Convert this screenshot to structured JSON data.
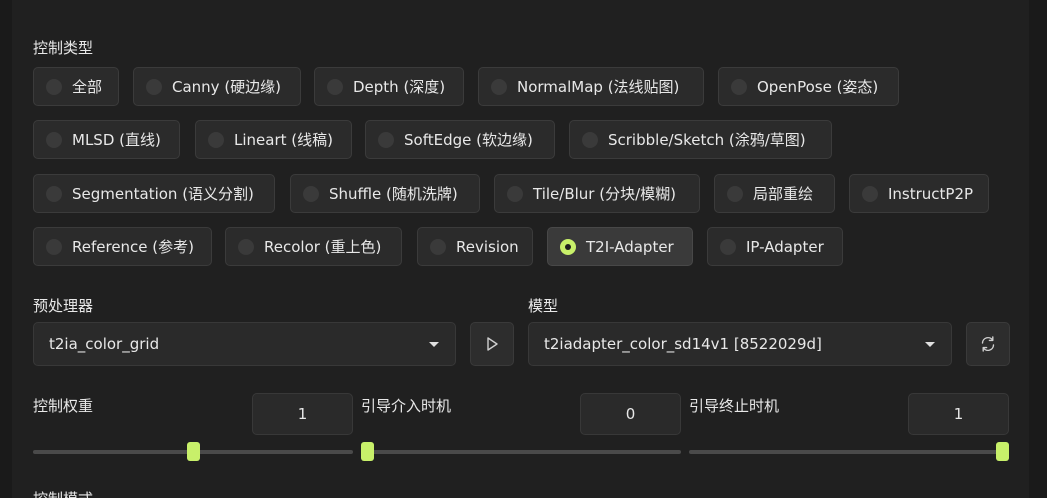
{
  "control_type": {
    "label": "控制类型",
    "options": [
      {
        "label": "全部",
        "selected": false
      },
      {
        "label": "Canny (硬边缘)",
        "selected": false
      },
      {
        "label": "Depth (深度)",
        "selected": false
      },
      {
        "label": "NormalMap (法线贴图)",
        "selected": false
      },
      {
        "label": "OpenPose (姿态)",
        "selected": false
      },
      {
        "label": "MLSD (直线)",
        "selected": false
      },
      {
        "label": "Lineart (线稿)",
        "selected": false
      },
      {
        "label": "SoftEdge (软边缘)",
        "selected": false
      },
      {
        "label": "Scribble/Sketch (涂鸦/草图)",
        "selected": false
      },
      {
        "label": "Segmentation (语义分割)",
        "selected": false
      },
      {
        "label": "Shuffle (随机洗牌)",
        "selected": false
      },
      {
        "label": "Tile/Blur (分块/模糊)",
        "selected": false
      },
      {
        "label": "局部重绘",
        "selected": false
      },
      {
        "label": "InstructP2P",
        "selected": false
      },
      {
        "label": "Reference (参考)",
        "selected": false
      },
      {
        "label": "Recolor (重上色)",
        "selected": false
      },
      {
        "label": "Revision",
        "selected": false
      },
      {
        "label": "T2I-Adapter",
        "selected": true
      },
      {
        "label": "IP-Adapter",
        "selected": false
      }
    ]
  },
  "preprocessor": {
    "label": "预处理器",
    "value": "t2ia_color_grid"
  },
  "model": {
    "label": "模型",
    "value": "t2iadapter_color_sd14v1 [8522029d]"
  },
  "control_weight": {
    "label": "控制权重",
    "value": "1",
    "fraction": 0.5
  },
  "guidance_start": {
    "label": "引导介入时机",
    "value": "0",
    "fraction": 0.0
  },
  "guidance_end": {
    "label": "引导终止时机",
    "value": "1",
    "fraction": 1.0
  },
  "control_mode": {
    "label": "控制模式"
  },
  "icons": {
    "run": "play-icon",
    "refresh": "refresh-icon"
  },
  "colors": {
    "accent": "#c8f06a",
    "background": "#1a1a1a",
    "panel": "#202020"
  }
}
